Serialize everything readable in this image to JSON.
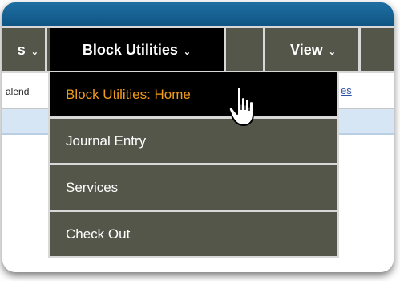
{
  "menubar": {
    "left_label": "s",
    "block_utilities_label": "Block Utilities",
    "view_label": "View",
    "chevron": "⌄"
  },
  "background": {
    "left_text": "alend",
    "right_link": "es"
  },
  "dropdown": {
    "items": [
      {
        "label": "Block Utilities: Home",
        "active": true
      },
      {
        "label": "Journal Entry",
        "active": false
      },
      {
        "label": "Services",
        "active": false
      },
      {
        "label": "Check Out",
        "active": false
      }
    ]
  },
  "colors": {
    "menu_bg": "#54564a",
    "active_bg": "#000000",
    "active_text": "#f39c1a",
    "top_bar": "#1f6fa2"
  },
  "icons": {
    "cursor": "hand-pointer-icon"
  }
}
